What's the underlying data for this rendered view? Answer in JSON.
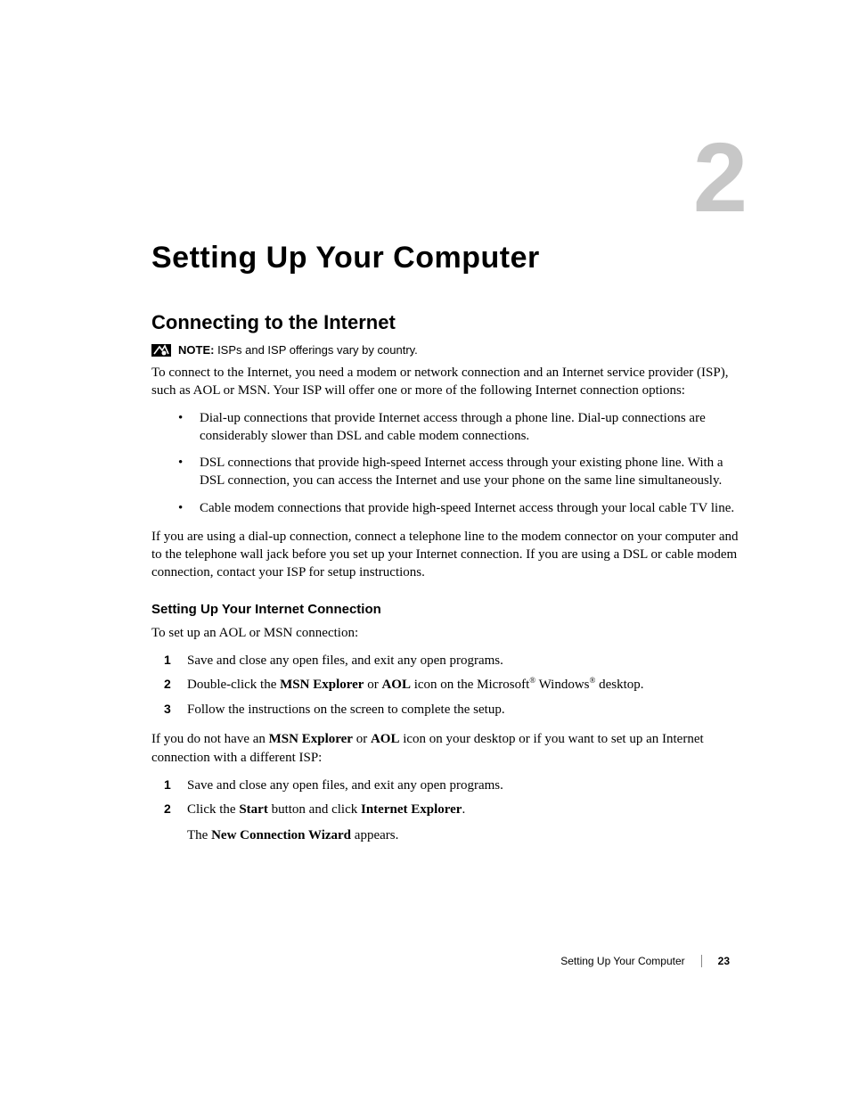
{
  "chapter": {
    "number": "2",
    "title": "Setting Up Your Computer"
  },
  "section": {
    "title": "Connecting to the Internet",
    "note": {
      "label": "NOTE:",
      "text": " ISPs and ISP offerings vary by country."
    },
    "intro": "To connect to the Internet, you need a modem or network connection and an Internet service provider (ISP), such as AOL or MSN. Your ISP will offer one or more of the following Internet connection options:",
    "bullets": [
      "Dial-up connections that provide Internet access through a phone line. Dial-up connections are considerably slower than DSL and cable modem connections.",
      "DSL connections that provide high-speed Internet access through your existing phone line. With a DSL connection, you can access the Internet and use your phone on the same line simultaneously.",
      "Cable modem connections that provide high-speed Internet access through your local cable TV line."
    ],
    "after_bullets": "If you are using a dial-up connection, connect a telephone line to the modem connector on your computer and to the telephone wall jack before you set up your Internet connection. If you are using a DSL or cable modem connection, contact your ISP for setup instructions."
  },
  "subsection": {
    "title": "Setting Up Your Internet Connection",
    "intro1": "To set up an AOL or MSN connection:",
    "steps1": [
      "Save and close any open files, and exit any open programs.",
      "Double-click the <b>MSN Explorer</b> or <b>AOL</b> icon on the Microsoft<sup>®</sup> Windows<sup>®</sup> desktop.",
      "Follow the instructions on the screen to complete the setup."
    ],
    "intro2_html": "If you do not have an <b>MSN Explorer</b> or <b>AOL</b> icon on your desktop or if you want to set up an Internet connection with a different ISP:",
    "steps2": [
      {
        "html": "Save and close any open files, and exit any open programs."
      },
      {
        "html": "Click the <b>Start</b> button and click <b>Internet Explorer</b>.",
        "sub": "The <b>New Connection Wizard</b> appears."
      }
    ]
  },
  "footer": {
    "title": "Setting Up Your Computer",
    "page": "23"
  }
}
